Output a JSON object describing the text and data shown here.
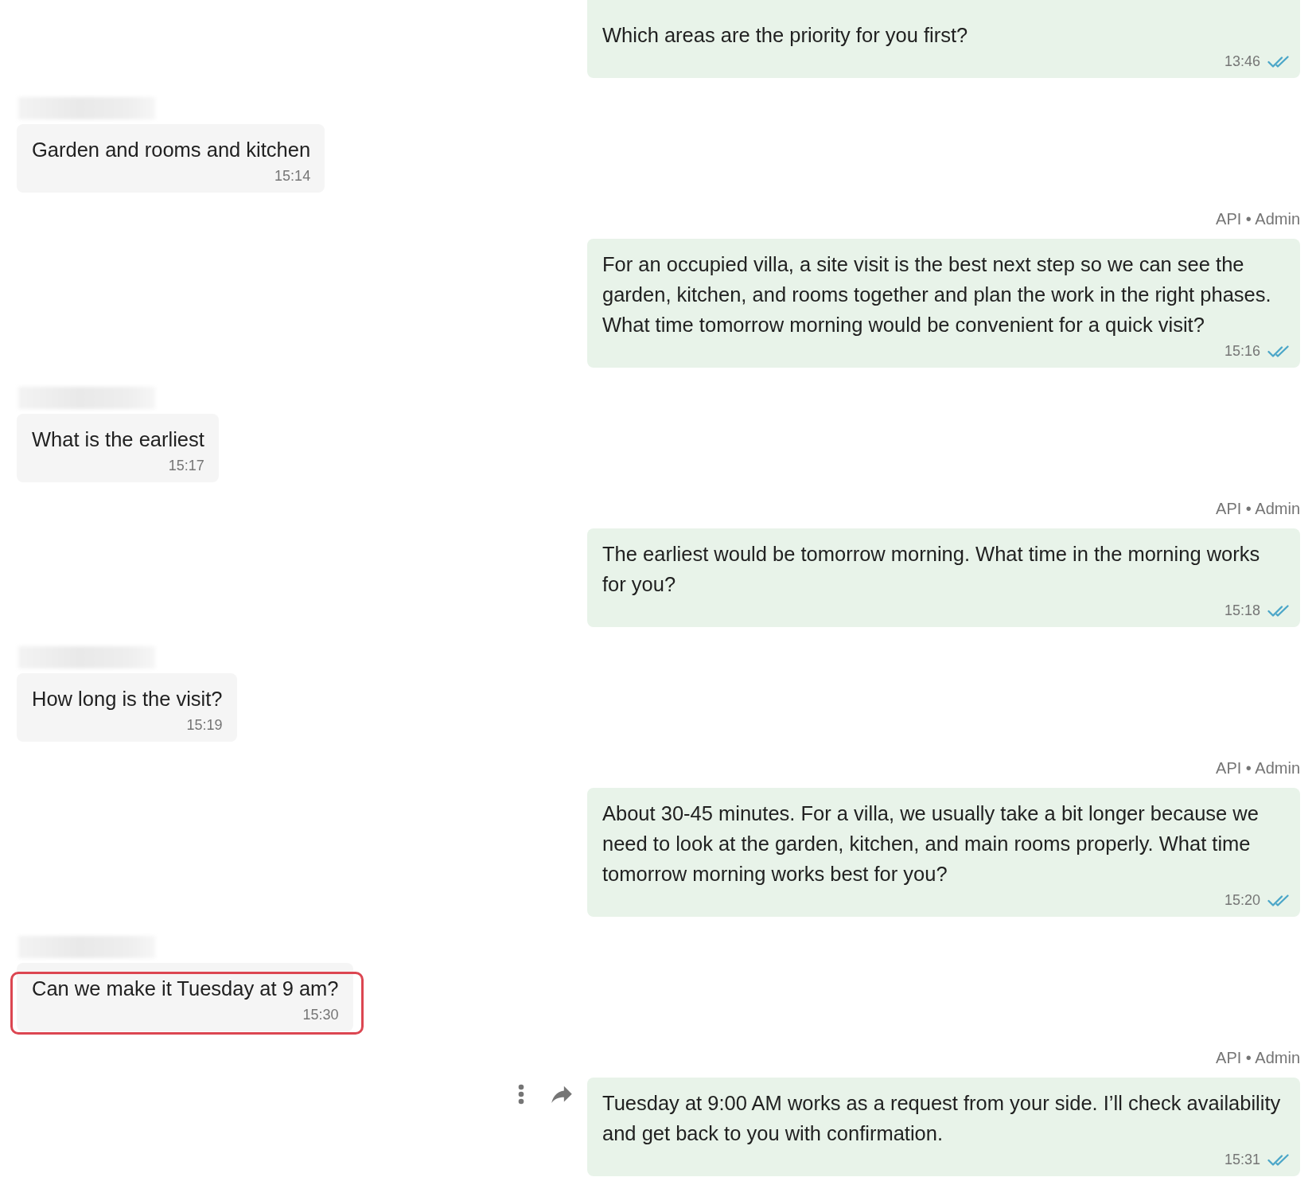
{
  "messages": [
    {
      "kind": "outgoing",
      "text": "Which areas are the priority for you first?",
      "time": "13:46",
      "read": true,
      "hover_actions": false
    },
    {
      "kind": "incoming",
      "text": "Garden and rooms and kitchen",
      "time": "15:14",
      "highlighted": false
    },
    {
      "kind": "outgoing",
      "sender": "API • Admin",
      "text": "For an occupied villa, a site visit is the best next step so we can see the garden, kitchen, and rooms together and plan the work in the right phases. What time tomorrow morning would be convenient for a quick visit?",
      "time": "15:16",
      "read": true,
      "hover_actions": false
    },
    {
      "kind": "incoming",
      "text": "What is the earliest",
      "time": "15:17",
      "highlighted": false
    },
    {
      "kind": "outgoing",
      "sender": "API • Admin",
      "text": "The earliest would be tomorrow morning. What time in the morning works for you?",
      "time": "15:18",
      "read": true,
      "hover_actions": false
    },
    {
      "kind": "incoming",
      "text": "How long is the visit?",
      "time": "15:19",
      "highlighted": false
    },
    {
      "kind": "outgoing",
      "sender": "API • Admin",
      "text": "About 30-45 minutes. For a villa, we usually take a bit longer because we need to look at the garden, kitchen, and main rooms properly. What time tomorrow morning works best for you?",
      "time": "15:20",
      "read": true,
      "hover_actions": false
    },
    {
      "kind": "incoming",
      "text": "Can we make it Tuesday at 9 am?",
      "time": "15:30",
      "highlighted": true
    },
    {
      "kind": "outgoing",
      "sender": "API • Admin",
      "text": "Tuesday at 9:00 AM works as a request from your side. I’ll check availability and get back to you with confirmation.",
      "time": "15:31",
      "read": true,
      "hover_actions": true
    }
  ]
}
